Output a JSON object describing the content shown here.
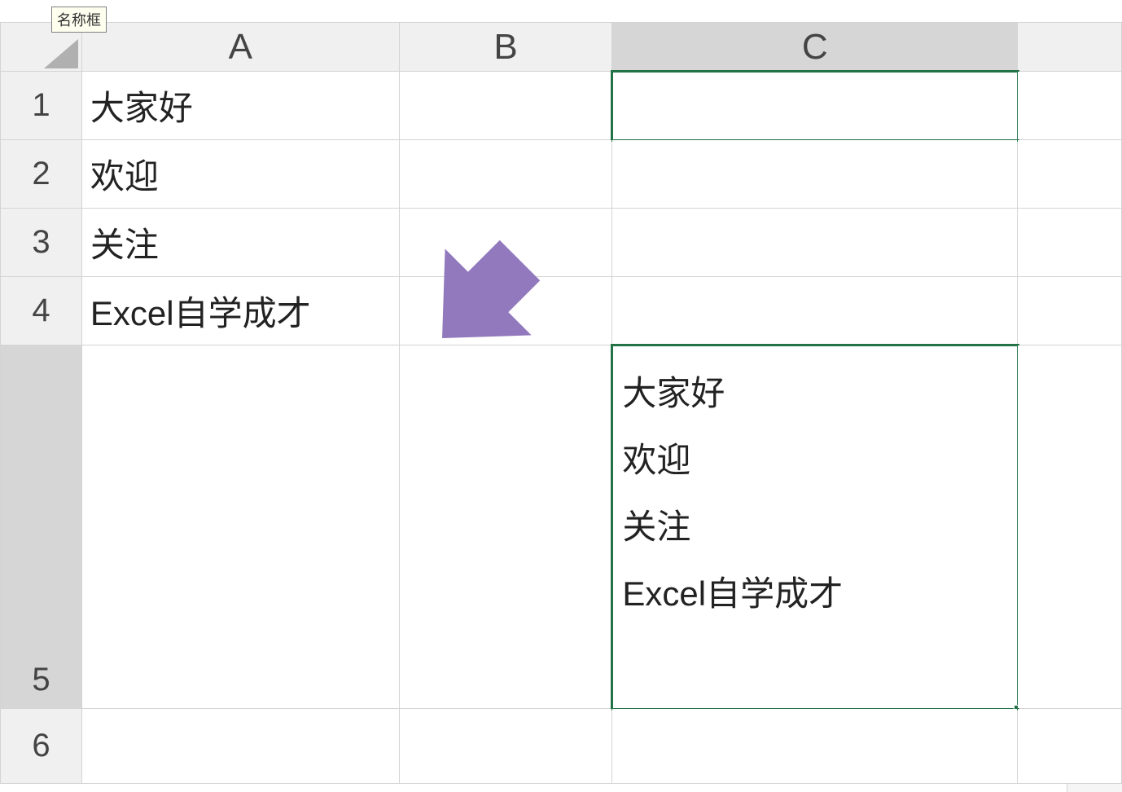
{
  "tooltip": {
    "label": "名称框"
  },
  "columns": {
    "a": "A",
    "b": "B",
    "c": "C"
  },
  "rows": {
    "r1": "1",
    "r2": "2",
    "r3": "3",
    "r4": "4",
    "r5": "5",
    "r6": "6"
  },
  "cells": {
    "a1": "大家好",
    "a2": "欢迎",
    "a3": "关注",
    "a4": "Excel自学成才",
    "c5": "大家好\n欢迎\n关注\nExcel自学成才"
  },
  "colors": {
    "selection": "#217346",
    "arrow": "#9279bd",
    "header_bg": "#f0f0f0",
    "border": "#d4d4d4"
  }
}
